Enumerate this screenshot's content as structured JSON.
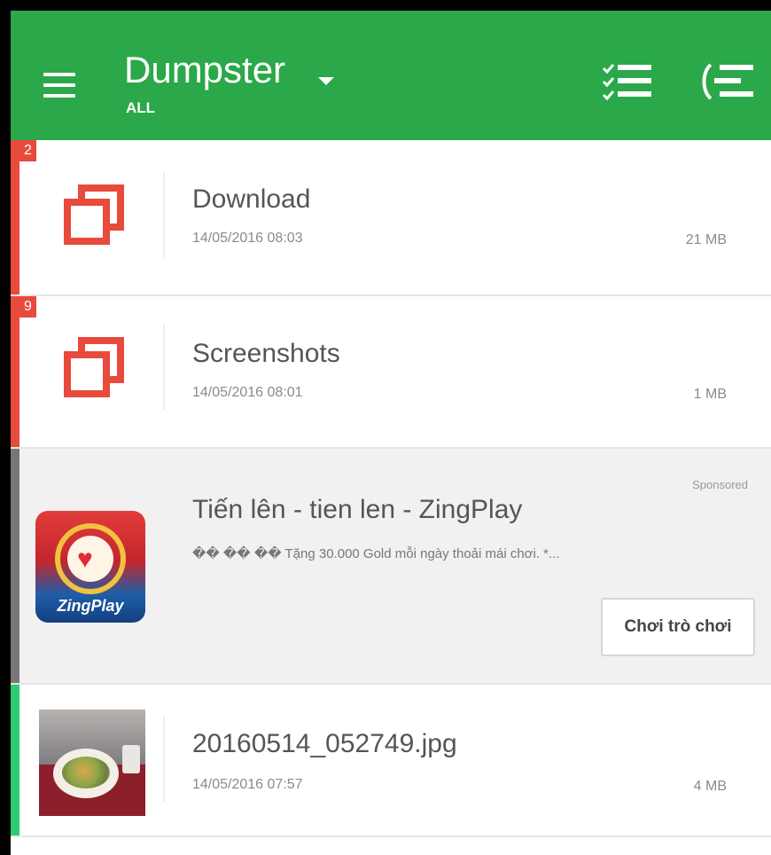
{
  "app": {
    "title": "Dumpster",
    "filter": "ALL"
  },
  "colors": {
    "appbar": "#2aa84a",
    "folder_accent": "#e84a3c",
    "ad_accent": "#777777",
    "image_accent": "#2ecc71"
  },
  "icons": {
    "menu": "menu-icon",
    "title_dropdown": "chevron-down-icon",
    "select": "checklist-icon",
    "collapse": "collapse-list-icon",
    "folder": "folder-stack-icon"
  },
  "items": [
    {
      "type": "folder",
      "badge": "2",
      "name": "Download",
      "date": "14/05/2016 08:03",
      "size": "21 MB"
    },
    {
      "type": "folder",
      "badge": "9",
      "name": "Screenshots",
      "date": "14/05/2016 08:01",
      "size": "1 MB"
    }
  ],
  "ad": {
    "sponsored_label": "Sponsored",
    "title": "Tiến lên - tien len - ZingPlay",
    "description": "�� �� �� Tặng 30.000 Gold mỗi ngày thoải mái chơi. *...",
    "brand": "ZingPlay",
    "cta": "Chơi trò chơi"
  },
  "image_item": {
    "name": "20160514_052749.jpg",
    "date": "14/05/2016 07:57",
    "size": "4 MB"
  }
}
